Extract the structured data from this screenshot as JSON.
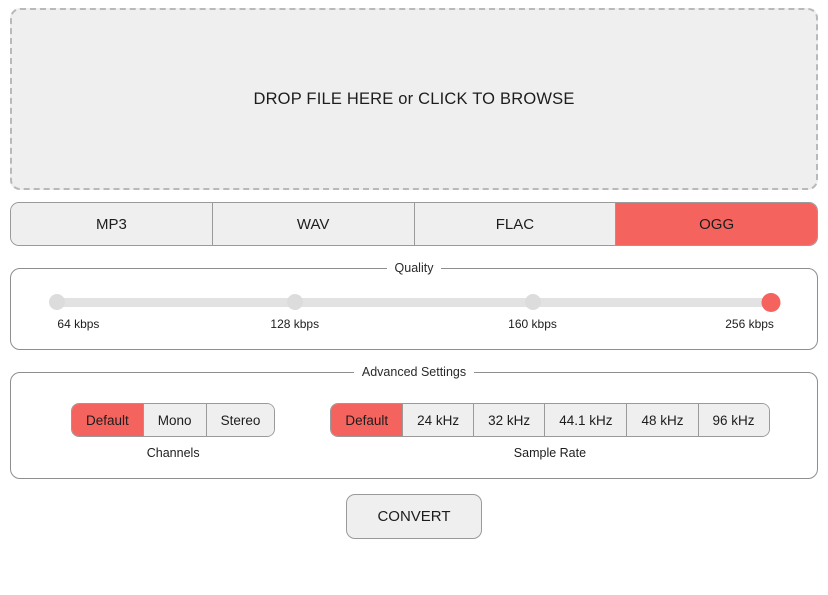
{
  "dropzone": {
    "label": "DROP FILE HERE or CLICK TO BROWSE"
  },
  "format_tabs": {
    "selected": "OGG",
    "items": [
      {
        "label": "MP3"
      },
      {
        "label": "WAV"
      },
      {
        "label": "FLAC"
      },
      {
        "label": "OGG"
      }
    ]
  },
  "quality": {
    "legend": "Quality",
    "selected": "256 kbps",
    "stops": [
      {
        "label": "64 kbps",
        "percent": 0
      },
      {
        "label": "128 kbps",
        "percent": 33.3
      },
      {
        "label": "160 kbps",
        "percent": 66.6
      },
      {
        "label": "256 kbps",
        "percent": 100
      }
    ]
  },
  "advanced": {
    "legend": "Advanced Settings",
    "channels": {
      "caption": "Channels",
      "selected": "Default",
      "options": [
        {
          "label": "Default"
        },
        {
          "label": "Mono"
        },
        {
          "label": "Stereo"
        }
      ]
    },
    "sample_rate": {
      "caption": "Sample Rate",
      "selected": "Default",
      "options": [
        {
          "label": "Default"
        },
        {
          "label": "24 kHz"
        },
        {
          "label": "32 kHz"
        },
        {
          "label": "44.1 kHz"
        },
        {
          "label": "48 kHz"
        },
        {
          "label": "96 kHz"
        }
      ]
    }
  },
  "convert": {
    "label": "CONVERT"
  },
  "colors": {
    "accent": "#F5635E",
    "surface": "#EFEFEF",
    "border": "#9A9A9A",
    "track": "#E2E2E2"
  }
}
